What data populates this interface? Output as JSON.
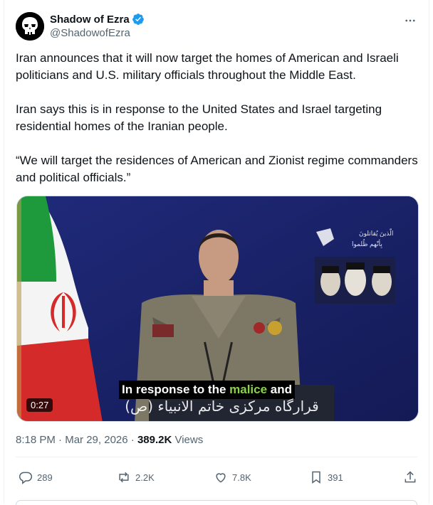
{
  "author": {
    "display_name": "Shadow of Ezra",
    "handle": "@ShadowofEzra",
    "verified": true,
    "avatar_icon": "skull-avatar-icon"
  },
  "tweet": {
    "paragraphs": [
      "Iran announces that it will now target the homes of American and Israeli politicians and U.S. military officials throughout the Middle East.",
      "Iran says this is in response to the United States and Israel targeting residential homes of the Iranian people.",
      "“We will target the residences of American and Zionist regime commanders and political officials.”"
    ]
  },
  "media": {
    "duration": "0:27",
    "caption_before": "In response to the ",
    "caption_highlight": "malice",
    "caption_after": " and",
    "caption_persian": "قرارگاه مرکزی خاتم الانبیاء (ص)"
  },
  "meta": {
    "time": "8:18 PM",
    "separator": " · ",
    "date": "Mar 29, 2026",
    "views_count": "389.2K",
    "views_label": " Views"
  },
  "actions": {
    "replies": "289",
    "reposts": "2.2K",
    "likes": "7.8K",
    "bookmarks": "391"
  },
  "colors": {
    "accent": "#1d9bf0",
    "text": "#0f1419",
    "secondary": "#536471",
    "caption_highlight": "#8bd14a"
  }
}
